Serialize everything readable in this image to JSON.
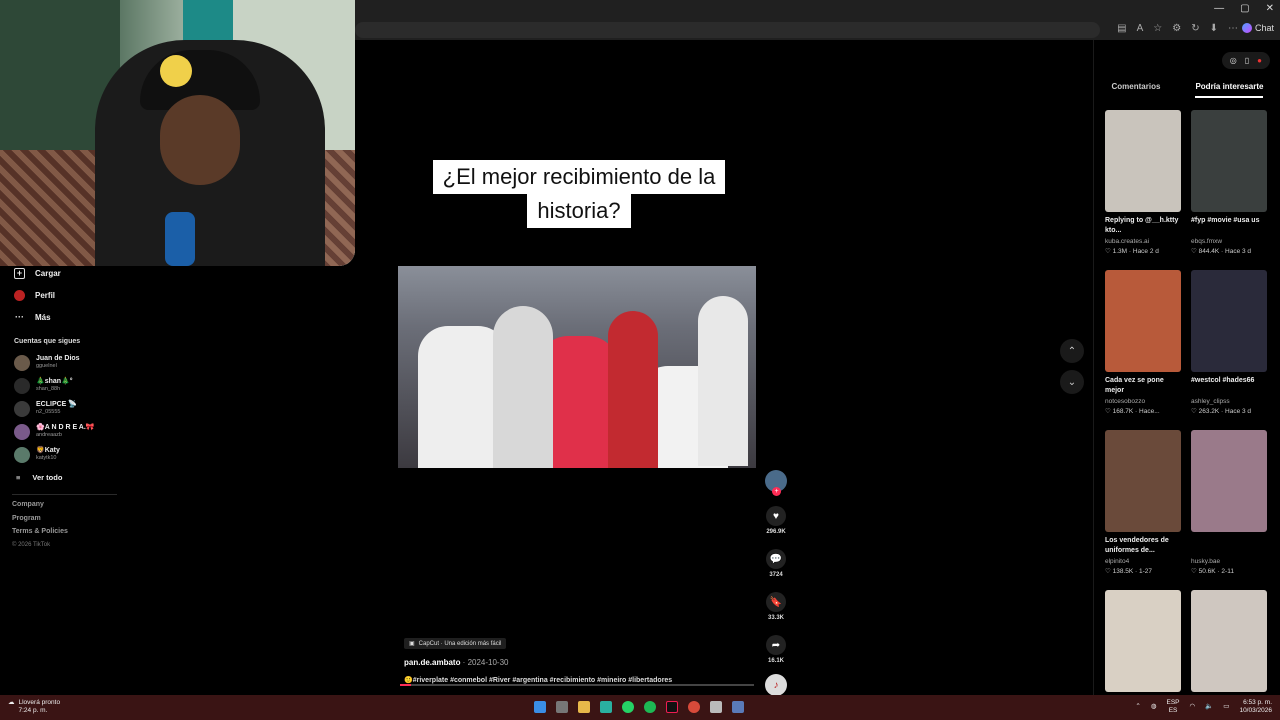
{
  "browser": {
    "window_controls": [
      "—",
      "▢",
      "✕"
    ],
    "chat_label": "Chat"
  },
  "nav": {
    "upload_label": "Cargar",
    "profile_label": "Perfil",
    "more_label": "Más",
    "following_title": "Cuentas que sigues",
    "following": [
      {
        "name": "Juan de Dios",
        "handle": "gguelnel"
      },
      {
        "name": "🎄shan🎄°",
        "handle": "shan_88h"
      },
      {
        "name": "ECLIPCE 📡",
        "handle": "n2_05555"
      },
      {
        "name": "🌸A N D R E A.🎀",
        "handle": "andreaazb"
      },
      {
        "name": "🦁Katy",
        "handle": "katytk10"
      }
    ],
    "see_all_label": "Ver todo",
    "footer_links": [
      "Company",
      "Program",
      "Terms & Policies"
    ],
    "copyright": "© 2026 TikTok"
  },
  "video": {
    "caption_line1": "¿El mejor recibimiento de la",
    "caption_line2": "historia?",
    "capcut_tag": "CapCut · Una edición más fácil",
    "author": "pan.de.ambato",
    "date": " · 2024-10-30",
    "description": "🙂#riverplate #conmebol #River #argentina #recibimiento #mineiro #libertadores",
    "progress": 0.03
  },
  "actions": {
    "likes": "296.9K",
    "comments": "3724",
    "saves": "33.3K",
    "shares": "16.1K"
  },
  "panel": {
    "tab_comments": "Comentarios",
    "tab_suggested": "Podría interesarte",
    "cards": [
      {
        "title": "Replying to @__h.ktty kto...",
        "author": "kuba.creates.ai",
        "likes": "1.3M",
        "age": "Hace 2 d",
        "color": "#c9c4bc"
      },
      {
        "title": "#fyp #movie #usa us",
        "author": "ebqs.fmxw",
        "likes": "844.4K",
        "age": "Hace 3 d",
        "color": "#3a3f3e"
      },
      {
        "title": "Cada vez se pone mejor",
        "author": "notcesobozzo",
        "likes": "168.7K",
        "age": "Hace...",
        "color": "#b85a3a"
      },
      {
        "title": "#westcol #hades66",
        "author": "ashley_clipss",
        "likes": "263.2K",
        "age": "Hace 3 d",
        "color": "#2a2a3a"
      },
      {
        "title": "Los vendedores de uniformes de...",
        "author": "elpinito4",
        "likes": "138.5K",
        "age": "1-27",
        "color": "#6a4a3a"
      },
      {
        "title": "",
        "author": "husky.bae",
        "likes": "50.6K",
        "age": "2-11",
        "color": "#9a7a8a"
      },
      {
        "title": "",
        "author": "",
        "likes": "",
        "age": "",
        "color": "#d9d0c4"
      },
      {
        "title": "",
        "author": "",
        "likes": "",
        "age": "",
        "color": "#cfc7c0"
      }
    ]
  },
  "taskbar": {
    "weather_title": "Lloverá pronto",
    "weather_time": "7:24 p. m.",
    "lang1": "ESP",
    "lang2": "ES",
    "clock_time": "6:53 p. m.",
    "clock_date": "10/03/2026"
  },
  "colors": {
    "accent": "#fe2c55",
    "taskbar": "#3a1414"
  }
}
